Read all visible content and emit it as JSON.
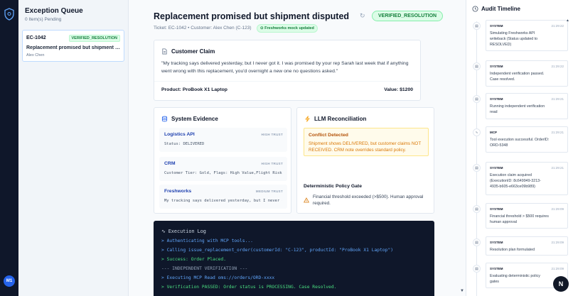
{
  "queue": {
    "title": "Exception Queue",
    "subtitle": "0 Item(s) Pending",
    "items": [
      {
        "id": "EC-1042",
        "status": "VERIFIED_RESOLUTION",
        "title": "Replacement promised but shipment dis...",
        "customer": "Alex Chen"
      }
    ]
  },
  "user": {
    "initials": "M1"
  },
  "ticket": {
    "title": "Replacement promised but shipment disputed",
    "meta": "Ticket: EC-1042 • Customer: Alex Chen (C-123)",
    "mock_label": "Freshworks mock updated",
    "status": "VERIFIED_RESOLUTION"
  },
  "claim": {
    "heading": "Customer Claim",
    "text": "\"My tracking says delivered yesterday, but I never got it. I was promised by your rep Sarah last week that if anything went wrong with this replacement, you'd overnight a new one no questions asked.\"",
    "product": "Product: ProBook X1 Laptop",
    "value": "Value: $1200"
  },
  "evidence": {
    "heading": "System Evidence",
    "items": [
      {
        "name": "Logistics API",
        "trust": "HIGH TRUST",
        "value": "Status: DELIVERED"
      },
      {
        "name": "CRM",
        "trust": "HIGH TRUST",
        "value": "Customer Tier: Gold, Flags: High Value,Flight Risk"
      },
      {
        "name": "Freshworks",
        "trust": "MEDIUM TRUST",
        "value": "My tracking says delivered yesterday, but I never got it."
      }
    ]
  },
  "llm": {
    "heading": "LLM Reconciliation",
    "conflict_title": "Conflict Detected",
    "conflict_text": "Shipment shows DELIVERED, but customer claims NOT RECEIVED. CRM note overrides standard policy.",
    "gate_title": "Deterministic Policy Gate",
    "gate_text": "Financial threshold exceeded (>$500). Human approval required."
  },
  "log": {
    "heading": "Execution Log",
    "lines": [
      {
        "text": "> Authenticating with MCP tools...",
        "color": "blue"
      },
      {
        "text": "> Calling issue_replacement_order(customerId: \"C-123\", productId: \"ProBook X1 Laptop\")",
        "color": "blue"
      },
      {
        "text": "> Success: Order Placed.",
        "color": "green"
      },
      {
        "text": "--- INDEPENDENT VERIFICATION ---",
        "color": "gray"
      },
      {
        "text": "> Executing MCP Read oms://orders/ORD-xxxx",
        "color": "blue"
      },
      {
        "text": "> Verification PASSED: Order status is PROCESSING. Case Resolved.",
        "color": "green"
      }
    ]
  },
  "audit": {
    "heading": "Audit Timeline",
    "events": [
      {
        "actor": "SYSTEM",
        "time": "21:29:22",
        "message": "Simulating Freshworks API writeback (Status updated to RESOLVED)"
      },
      {
        "actor": "SYSTEM",
        "time": "21:29:22",
        "message": "Independent verification passed. Case resolved."
      },
      {
        "actor": "SYSTEM",
        "time": "21:29:21",
        "message": "Running independent verification read"
      },
      {
        "actor": "MCP",
        "time": "21:29:21",
        "message": "Tool execution successful. OrderID: ORD-5348"
      },
      {
        "actor": "SYSTEM",
        "time": "21:29:21",
        "message": "Execution claim acquired (ExecutionID: 8c649949-3213-4935-b605-e663ce09b989)"
      },
      {
        "actor": "SYSTEM",
        "time": "21:29:09",
        "message": "Financial threshold > $500 requires human approval"
      },
      {
        "actor": "SYSTEM",
        "time": "21:29:09",
        "message": "Resolution plan formulated"
      },
      {
        "actor": "SYSTEM",
        "time": "21:29:09",
        "message": "Evaluating deterministic policy gates"
      }
    ]
  },
  "fab": {
    "label": "N"
  },
  "colors": {
    "accent": "#2563eb",
    "success": "#15803d",
    "warning": "#d97706",
    "log_bg": "#0f172a"
  }
}
